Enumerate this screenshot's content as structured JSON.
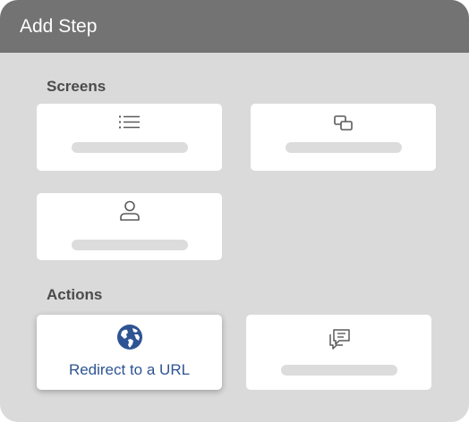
{
  "dialog": {
    "title": "Add Step"
  },
  "sections": {
    "screens_label": "Screens",
    "actions_label": "Actions"
  },
  "screens": [
    {
      "icon": "list-icon"
    },
    {
      "icon": "overlapping-windows-icon"
    },
    {
      "icon": "user-icon"
    }
  ],
  "actions": [
    {
      "icon": "globe-icon",
      "label": "Redirect to a URL",
      "selected": true
    },
    {
      "icon": "chat-message-icon"
    }
  ],
  "colors": {
    "titlebar": "#737373",
    "dialog_background": "#dadada",
    "card_background": "#ffffff",
    "accent": "#2e5493",
    "icon_gray": "#5a5a5a",
    "placeholder": "#dcdcdc"
  }
}
